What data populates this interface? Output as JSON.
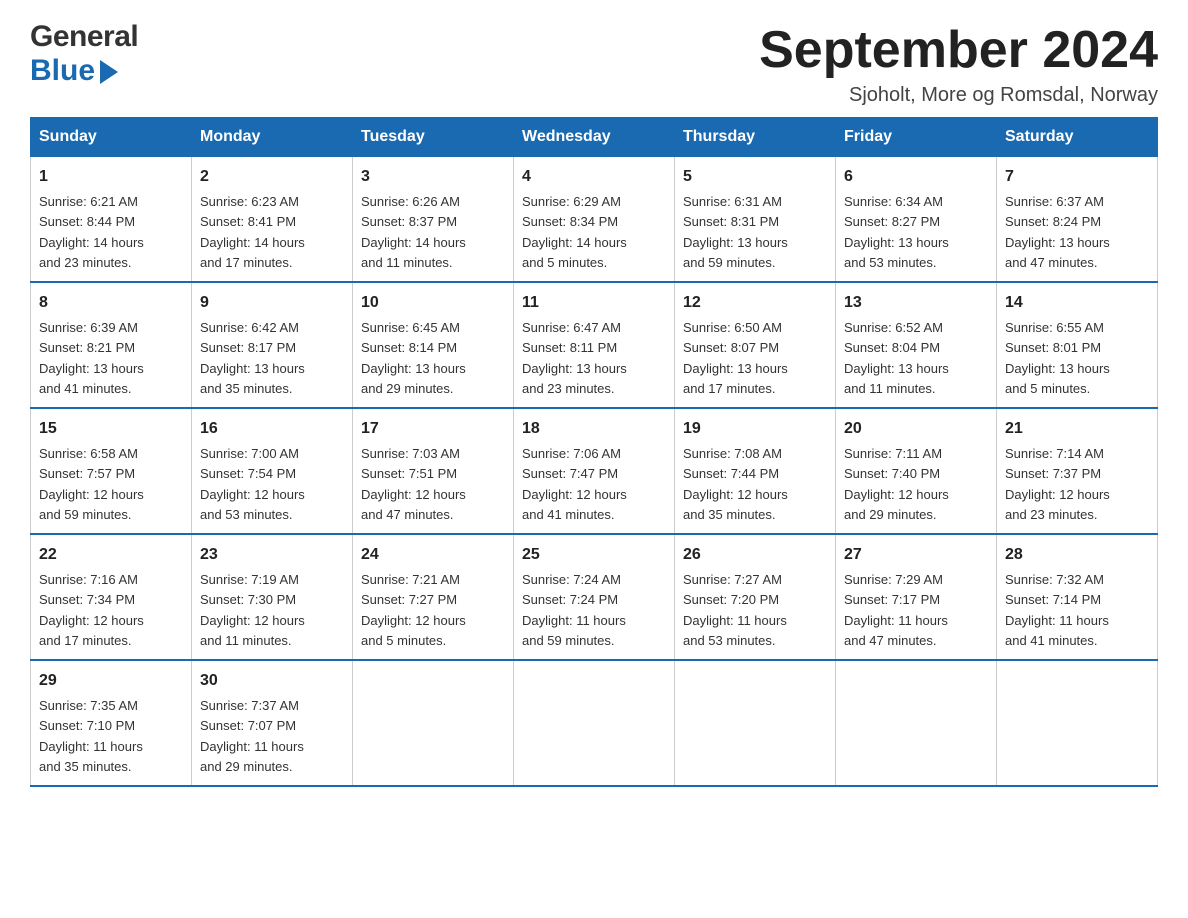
{
  "header": {
    "logo_line1": "General",
    "logo_line2": "Blue",
    "month_title": "September 2024",
    "location": "Sjoholt, More og Romsdal, Norway"
  },
  "weekdays": [
    "Sunday",
    "Monday",
    "Tuesday",
    "Wednesday",
    "Thursday",
    "Friday",
    "Saturday"
  ],
  "weeks": [
    [
      {
        "day": "1",
        "sunrise": "6:21 AM",
        "sunset": "8:44 PM",
        "daylight": "14 hours and 23 minutes."
      },
      {
        "day": "2",
        "sunrise": "6:23 AM",
        "sunset": "8:41 PM",
        "daylight": "14 hours and 17 minutes."
      },
      {
        "day": "3",
        "sunrise": "6:26 AM",
        "sunset": "8:37 PM",
        "daylight": "14 hours and 11 minutes."
      },
      {
        "day": "4",
        "sunrise": "6:29 AM",
        "sunset": "8:34 PM",
        "daylight": "14 hours and 5 minutes."
      },
      {
        "day": "5",
        "sunrise": "6:31 AM",
        "sunset": "8:31 PM",
        "daylight": "13 hours and 59 minutes."
      },
      {
        "day": "6",
        "sunrise": "6:34 AM",
        "sunset": "8:27 PM",
        "daylight": "13 hours and 53 minutes."
      },
      {
        "day": "7",
        "sunrise": "6:37 AM",
        "sunset": "8:24 PM",
        "daylight": "13 hours and 47 minutes."
      }
    ],
    [
      {
        "day": "8",
        "sunrise": "6:39 AM",
        "sunset": "8:21 PM",
        "daylight": "13 hours and 41 minutes."
      },
      {
        "day": "9",
        "sunrise": "6:42 AM",
        "sunset": "8:17 PM",
        "daylight": "13 hours and 35 minutes."
      },
      {
        "day": "10",
        "sunrise": "6:45 AM",
        "sunset": "8:14 PM",
        "daylight": "13 hours and 29 minutes."
      },
      {
        "day": "11",
        "sunrise": "6:47 AM",
        "sunset": "8:11 PM",
        "daylight": "13 hours and 23 minutes."
      },
      {
        "day": "12",
        "sunrise": "6:50 AM",
        "sunset": "8:07 PM",
        "daylight": "13 hours and 17 minutes."
      },
      {
        "day": "13",
        "sunrise": "6:52 AM",
        "sunset": "8:04 PM",
        "daylight": "13 hours and 11 minutes."
      },
      {
        "day": "14",
        "sunrise": "6:55 AM",
        "sunset": "8:01 PM",
        "daylight": "13 hours and 5 minutes."
      }
    ],
    [
      {
        "day": "15",
        "sunrise": "6:58 AM",
        "sunset": "7:57 PM",
        "daylight": "12 hours and 59 minutes."
      },
      {
        "day": "16",
        "sunrise": "7:00 AM",
        "sunset": "7:54 PM",
        "daylight": "12 hours and 53 minutes."
      },
      {
        "day": "17",
        "sunrise": "7:03 AM",
        "sunset": "7:51 PM",
        "daylight": "12 hours and 47 minutes."
      },
      {
        "day": "18",
        "sunrise": "7:06 AM",
        "sunset": "7:47 PM",
        "daylight": "12 hours and 41 minutes."
      },
      {
        "day": "19",
        "sunrise": "7:08 AM",
        "sunset": "7:44 PM",
        "daylight": "12 hours and 35 minutes."
      },
      {
        "day": "20",
        "sunrise": "7:11 AM",
        "sunset": "7:40 PM",
        "daylight": "12 hours and 29 minutes."
      },
      {
        "day": "21",
        "sunrise": "7:14 AM",
        "sunset": "7:37 PM",
        "daylight": "12 hours and 23 minutes."
      }
    ],
    [
      {
        "day": "22",
        "sunrise": "7:16 AM",
        "sunset": "7:34 PM",
        "daylight": "12 hours and 17 minutes."
      },
      {
        "day": "23",
        "sunrise": "7:19 AM",
        "sunset": "7:30 PM",
        "daylight": "12 hours and 11 minutes."
      },
      {
        "day": "24",
        "sunrise": "7:21 AM",
        "sunset": "7:27 PM",
        "daylight": "12 hours and 5 minutes."
      },
      {
        "day": "25",
        "sunrise": "7:24 AM",
        "sunset": "7:24 PM",
        "daylight": "11 hours and 59 minutes."
      },
      {
        "day": "26",
        "sunrise": "7:27 AM",
        "sunset": "7:20 PM",
        "daylight": "11 hours and 53 minutes."
      },
      {
        "day": "27",
        "sunrise": "7:29 AM",
        "sunset": "7:17 PM",
        "daylight": "11 hours and 47 minutes."
      },
      {
        "day": "28",
        "sunrise": "7:32 AM",
        "sunset": "7:14 PM",
        "daylight": "11 hours and 41 minutes."
      }
    ],
    [
      {
        "day": "29",
        "sunrise": "7:35 AM",
        "sunset": "7:10 PM",
        "daylight": "11 hours and 35 minutes."
      },
      {
        "day": "30",
        "sunrise": "7:37 AM",
        "sunset": "7:07 PM",
        "daylight": "11 hours and 29 minutes."
      },
      null,
      null,
      null,
      null,
      null
    ]
  ],
  "labels": {
    "sunrise": "Sunrise:",
    "sunset": "Sunset:",
    "daylight": "Daylight:"
  }
}
